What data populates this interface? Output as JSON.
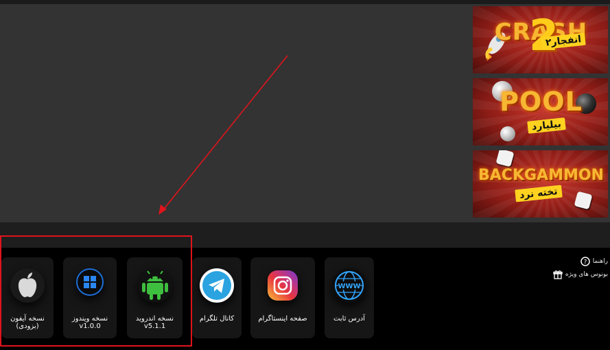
{
  "banners": [
    {
      "title": "CRASH",
      "number": "2",
      "tag": "انفجار۲"
    },
    {
      "title": "POOL",
      "tag": "بیلیارد"
    },
    {
      "title": "BACKGAMMON",
      "tag": "تخته نرد"
    }
  ],
  "sidebar_links": [
    {
      "icon": "question-circle-icon",
      "label": "راهنما"
    },
    {
      "icon": "gift-icon",
      "label": "بونوس های ویژه"
    }
  ],
  "app_cards": [
    {
      "icon": "apple-icon",
      "line1": "نسخه آیفون",
      "line2": "(بزودی)"
    },
    {
      "icon": "windows-icon",
      "line1": "نسخه ویندوز",
      "line2": "v1.0.0"
    },
    {
      "icon": "android-icon",
      "line1": "نسخه اندروید",
      "line2": "v5.1.1"
    },
    {
      "icon": "telegram-icon",
      "line1": "کانال تلگرام",
      "line2": ""
    },
    {
      "icon": "instagram-icon",
      "line1": "صفحه اینستاگرام",
      "line2": ""
    },
    {
      "icon": "globe-www-icon",
      "line1": "آدرس ثابت",
      "line2": "",
      "badge": "WWW"
    }
  ],
  "colors": {
    "annotation_red": "#e0141c",
    "card_bg": "#161616",
    "content_bg": "#333333"
  }
}
